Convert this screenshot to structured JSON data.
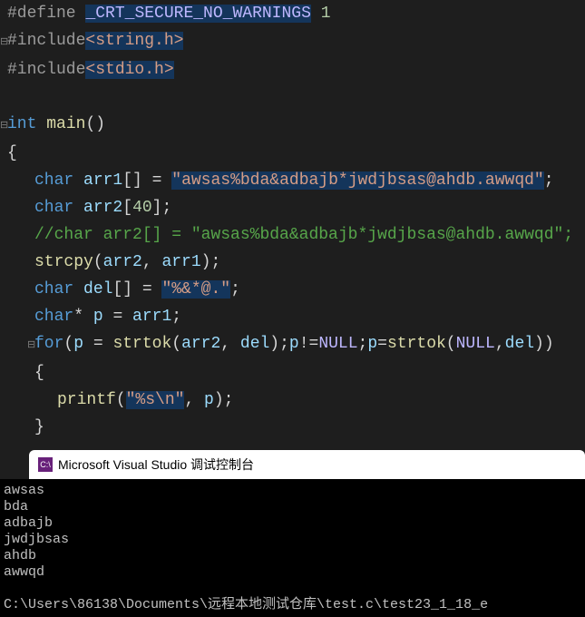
{
  "code": {
    "l1_kw": "#define",
    "l1_macro": "_CRT_SECURE_NO_WARNINGS",
    "l1_val": "1",
    "l2_kw": "#include",
    "l2_hdr": "<string.h>",
    "l3_kw": "#include",
    "l3_hdr": "<stdio.h>",
    "l5_type": "int",
    "l5_fn": "main",
    "l5_par": "()",
    "l6": "{",
    "l7_type": "char",
    "l7_var": "arr1",
    "l7_br": "[] = ",
    "l7_str": "\"awsas%bda&adbajb*jwdjbsas@ahdb.awwqd\"",
    "l7_end": ";",
    "l8_type": "char",
    "l8_var": "arr2",
    "l8_br": "[",
    "l8_num": "40",
    "l8_br2": "];",
    "l9": "//char arr2[] = \"awsas%bda&adbajb*jwdjbsas@ahdb.awwqd\";",
    "l10_fn": "strcpy",
    "l10_args_a": "arr2",
    "l10_args_b": "arr1",
    "l11_type": "char",
    "l11_var": "del",
    "l11_br": "[] = ",
    "l11_str": "\"%&*@.\"",
    "l11_end": ";",
    "l12_type": "char",
    "l12_star": "* ",
    "l12_var": "p",
    "l12_eq": " = ",
    "l12_rhs": "arr1",
    "l12_end": ";",
    "l13_for": "for",
    "l13_p": "p",
    "l13_eq": " = ",
    "l13_strtok": "strtok",
    "l13_arr2": "arr2",
    "l13_del": "del",
    "l13_null": "NULL",
    "l14": "{",
    "l15_fn": "printf",
    "l15_str": "\"%s\\n\"",
    "l15_p": "p",
    "l16": "}",
    "l17": "}"
  },
  "console": {
    "icon_text": "C:\\",
    "title": "Microsoft Visual Studio 调试控制台",
    "output": "awsas\nbda\nadbajb\njwdjbsas\nahdb\nawwqd\n\nC:\\Users\\86138\\Documents\\远程本地测试仓库\\test.c\\test23_1_18_e"
  }
}
